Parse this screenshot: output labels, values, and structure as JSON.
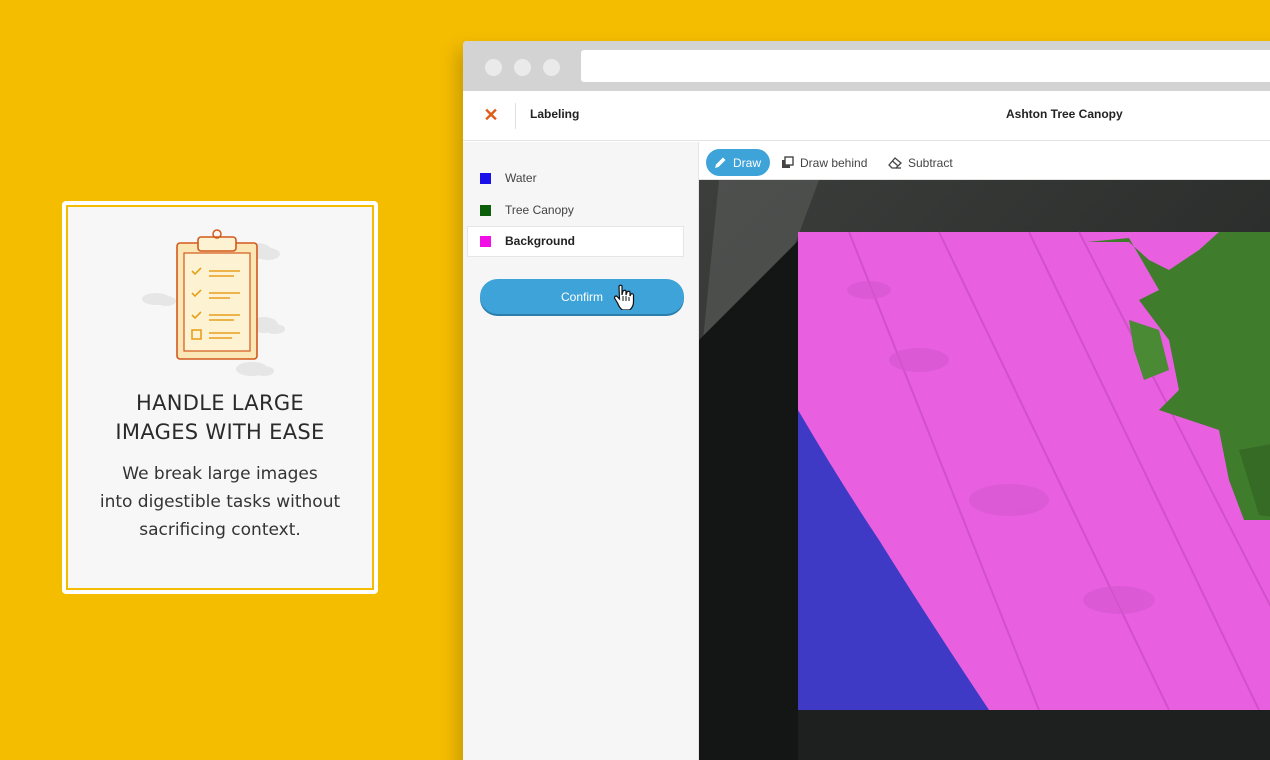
{
  "feature_card": {
    "title_line1": "HANDLE LARGE",
    "title_line2": "IMAGES WITH EASE",
    "desc_line1": "We break large images",
    "desc_line2": "into digestible tasks without",
    "desc_line3": "sacrificing context.",
    "icon": "clipboard-checklist-icon"
  },
  "browser": {
    "url_icon": "search-icon",
    "url_value": ""
  },
  "appbar": {
    "close_icon": "close-icon",
    "close_glyph": "✕",
    "section_label": "Labeling",
    "project_title": "Ashton Tree Canopy"
  },
  "labels": [
    {
      "name": "Water",
      "color": "#1A10E8"
    },
    {
      "name": "Tree Canopy",
      "color": "#0B5F0B"
    },
    {
      "name": "Background",
      "color": "#F20FE6"
    }
  ],
  "selected_label": "Background",
  "confirm_label": "Confirm",
  "toolbar": {
    "draw": "Draw",
    "draw_behind": "Draw behind",
    "subtract": "Subtract",
    "active_tool": "Draw"
  },
  "colors": {
    "page_bg": "#F5BD00",
    "accent": "#3EA3D8",
    "close": "#E05A1A"
  }
}
